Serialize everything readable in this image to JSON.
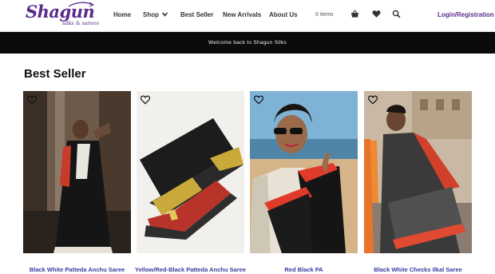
{
  "logo": {
    "wordmark": "Shagun",
    "tagline": "silks & sarees"
  },
  "nav": {
    "items": [
      {
        "label": "Home"
      },
      {
        "label": "Shop"
      },
      {
        "label": "Best Seller"
      },
      {
        "label": "New Arrivals"
      },
      {
        "label": "About Us"
      }
    ],
    "cart_count": "0 items",
    "login_label": "Login/Registration"
  },
  "announcement": "Welcome back to Shagun Silks",
  "section": {
    "title": "Best Seller"
  },
  "products": [
    {
      "title": "Black White Patteda Anchu Saree"
    },
    {
      "title": "Yellow/Red-Black Patteda Anchu Saree"
    },
    {
      "title": "Red Black PA"
    },
    {
      "title": "Black White Checks Ilkal Saree"
    }
  ],
  "colors": {
    "brand": "#5b2b8c",
    "link": "#3a3aa0",
    "announcement_bg": "#0b0b0b"
  }
}
